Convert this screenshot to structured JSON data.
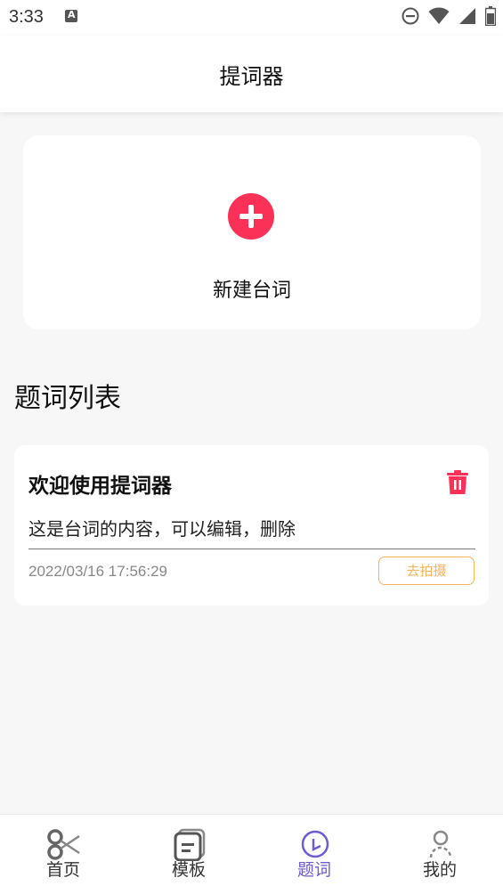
{
  "status_bar": {
    "time": "3:33"
  },
  "header": {
    "title": "提词器"
  },
  "new_script": {
    "label": "新建台词"
  },
  "list": {
    "title": "题词列表",
    "items": [
      {
        "title": "欢迎使用提词器",
        "content": "这是台词的内容，可以编辑，删除",
        "date": "2022/03/16 17:56:29",
        "action_label": "去拍摄"
      }
    ]
  },
  "tab_bar": {
    "active": "题词",
    "tabs": [
      {
        "label": "首页",
        "icon": "scissors-icon"
      },
      {
        "label": "模板",
        "icon": "template-icon"
      },
      {
        "label": "题词",
        "icon": "prompter-icon"
      },
      {
        "label": "我的",
        "icon": "profile-icon"
      }
    ]
  },
  "colors": {
    "accent": "#fb3158",
    "active_tab": "#6d5bd0",
    "action_button": "#f5b45f"
  }
}
